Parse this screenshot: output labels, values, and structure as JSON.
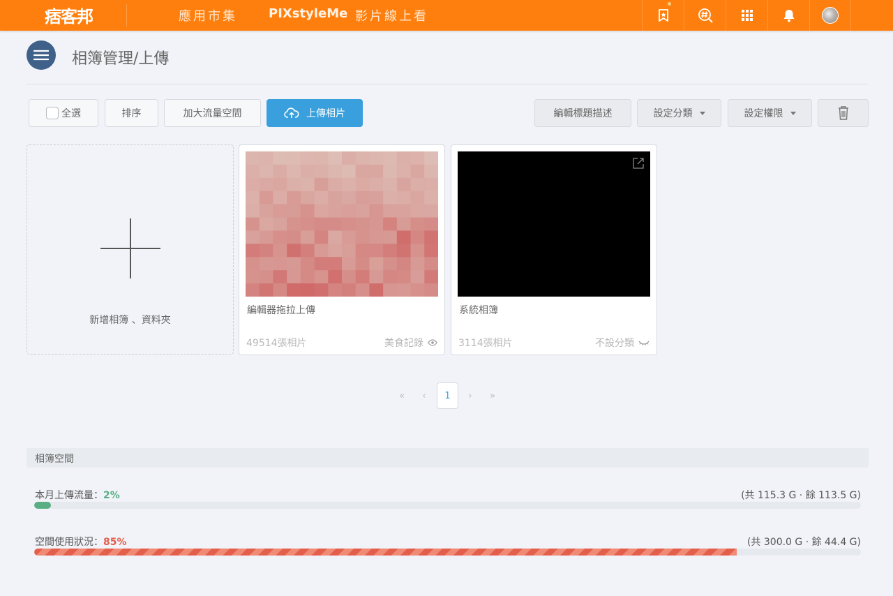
{
  "header": {
    "logo": "痞客邦",
    "nav": [
      "應用市集",
      "PIXstyleMe",
      "影片線上看"
    ],
    "icons": [
      "bookmark-star-icon",
      "hashtag-search-icon",
      "apps-grid-icon",
      "bell-icon",
      "avatar"
    ]
  },
  "page": {
    "title": "相簿管理/上傳"
  },
  "toolbar": {
    "select_all": "全選",
    "sort": "排序",
    "expand_traffic": "加大流量空間",
    "upload": "上傳相片",
    "edit_title": "編輯標題描述",
    "set_category": "設定分類",
    "set_permission": "設定權限"
  },
  "add_card": {
    "label": "新增相簿 、資料夾"
  },
  "albums": [
    {
      "title": "編輯器拖拉上傳",
      "count": "49514張相片",
      "category": "美食記錄",
      "visibility": "eye-icon"
    },
    {
      "title": "系統相簿",
      "count": "3114張相片",
      "category": "不設分類",
      "visibility": "eye-closed-icon"
    }
  ],
  "pagination": {
    "first": "«",
    "prev": "‹",
    "current": "1",
    "next": "›",
    "last": "»"
  },
  "storage": {
    "header": "相簿空間",
    "traffic_label": "本月上傳流量：",
    "traffic_percent": "2%",
    "traffic_fraction": 0.02,
    "traffic_total": "(共 115.3 G · 餘 113.5 G)",
    "space_label": "空間使用狀況：",
    "space_percent": "85%",
    "space_fraction": 0.85,
    "space_total": "(共 300.0 G · 餘 44.4 G)"
  },
  "colors": {
    "brand": "#ff7f0e",
    "primary": "#3a9fdd",
    "good": "#5aae84",
    "warn": "#e35f4c"
  }
}
